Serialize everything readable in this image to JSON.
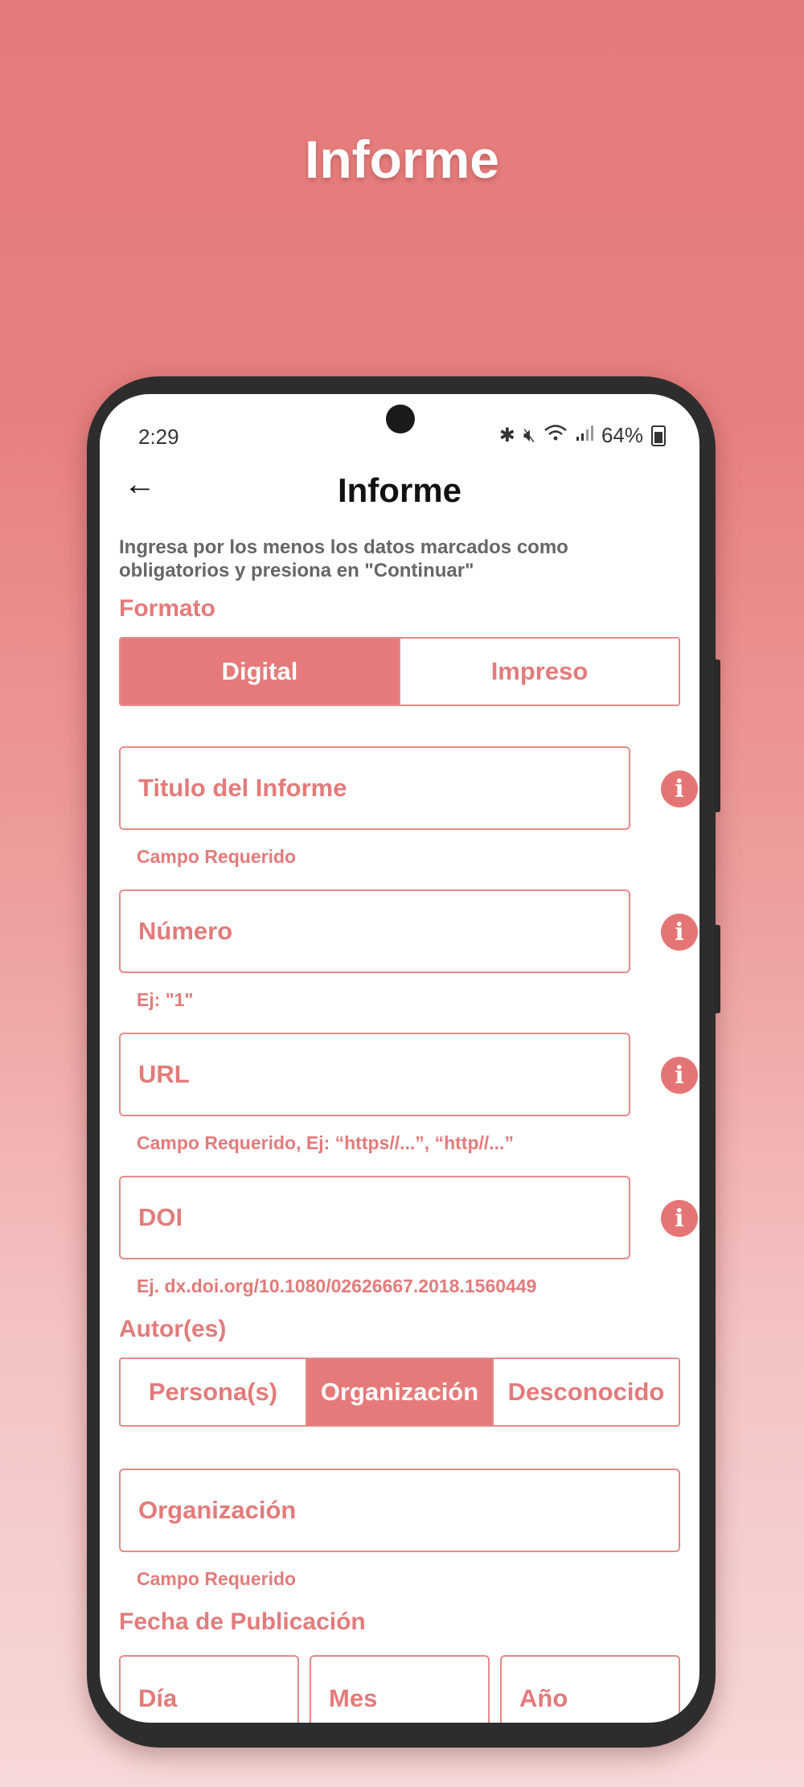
{
  "headline": "Informe",
  "status": {
    "time": "2:29",
    "battery": "64%"
  },
  "appbar": {
    "back_glyph": "←",
    "title": "Informe"
  },
  "instructions": "Ingresa por los menos los datos marcados como obligatorios y presiona en \"Continuar\"",
  "formato": {
    "label": "Formato",
    "options": [
      "Digital",
      "Impreso"
    ],
    "selected": "Digital"
  },
  "fields": {
    "titulo": {
      "placeholder": "Titulo del Informe",
      "hint": "Campo Requerido"
    },
    "numero": {
      "placeholder": "Número",
      "hint": "Ej: \"1\""
    },
    "url": {
      "placeholder": "URL",
      "hint": "Campo Requerido, Ej: “https//...”, “http//...”"
    },
    "doi": {
      "placeholder": "DOI",
      "hint": "Ej. dx.doi.org/10.1080/02626667.2018.1560449"
    }
  },
  "autores": {
    "label": "Autor(es)",
    "options": [
      "Persona(s)",
      "Organización",
      "Desconocido"
    ],
    "selected": "Organización"
  },
  "organizacion": {
    "placeholder": "Organización",
    "hint": "Campo Requerido"
  },
  "fecha": {
    "label": "Fecha de Publicación",
    "dia": "Día",
    "mes": "Mes",
    "anio": "Año"
  },
  "icons": {
    "info": "i"
  },
  "colors": {
    "accent": "#e67a7a",
    "bg_top": "#e57a7a",
    "bg_bottom": "#f7d8d8"
  }
}
